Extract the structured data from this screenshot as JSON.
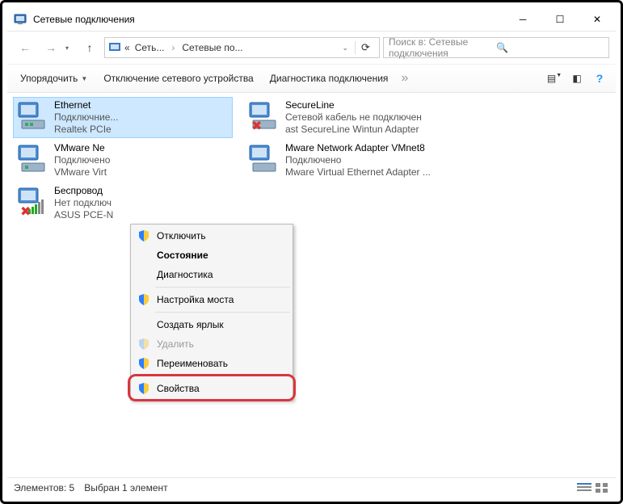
{
  "window": {
    "title": "Сетевые подключения"
  },
  "breadcrumbs": {
    "root": "Сеть...",
    "current": "Сетевые по..."
  },
  "search": {
    "placeholder": "Поиск в: Сетевые подключения"
  },
  "toolbar": {
    "organize": "Упорядочить",
    "disable": "Отключение сетевого устройства",
    "diag": "Диагностика подключения"
  },
  "connections": [
    {
      "name": "Ethernet",
      "status": "Подключние...",
      "device": "Realtek PCIe",
      "selected": true,
      "kind": "eth"
    },
    {
      "name": "VMware Ne",
      "status": "Подключено",
      "device": "VMware Virt",
      "kind": "eth"
    },
    {
      "name": "Беспровод",
      "status": "Нет подключ",
      "device": "ASUS PCE-N",
      "kind": "wifi-off"
    },
    {
      "name": "SecureLine",
      "status": "Сетевой кабель не подключен",
      "device": "ast SecureLine Wintun Adapter",
      "kind": "eth-off"
    },
    {
      "name": "Mware Network Adapter VMnet8",
      "status": "Подключено",
      "device": "Mware Virtual Ethernet Adapter ...",
      "kind": "eth"
    }
  ],
  "context": {
    "disable": "Отключить",
    "status": "Состояние",
    "diag": "Диагностика",
    "bridge": "Настройка моста",
    "shortcut": "Создать ярлык",
    "delete": "Удалить",
    "rename": "Переименовать",
    "props": "Свойства"
  },
  "statusbar": {
    "count": "Элементов: 5",
    "selected": "Выбран 1 элемент"
  }
}
